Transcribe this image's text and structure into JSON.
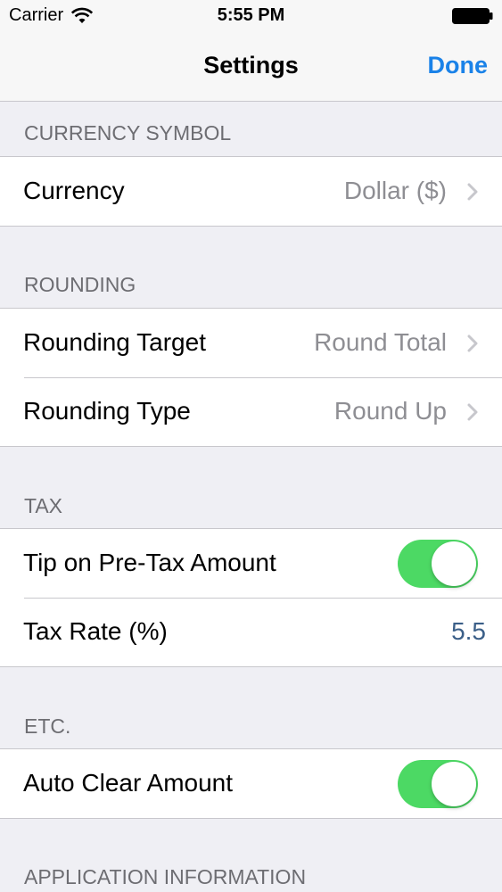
{
  "status_bar": {
    "carrier": "Carrier",
    "time": "5:55 PM",
    "wifi_icon": "wifi-icon",
    "battery_icon": "battery-icon"
  },
  "nav": {
    "title": "Settings",
    "done_label": "Done",
    "accent_color": "#1a82e8"
  },
  "sections": {
    "currency": {
      "header": "CURRENCY SYMBOL",
      "currency_label": "Currency",
      "currency_value": "Dollar ($)"
    },
    "rounding": {
      "header": "ROUNDING",
      "target_label": "Rounding Target",
      "target_value": "Round Total",
      "type_label": "Rounding Type",
      "type_value": "Round Up"
    },
    "tax": {
      "header": "TAX",
      "tip_label": "Tip on Pre-Tax Amount",
      "tip_enabled": true,
      "rate_label": "Tax Rate (%)",
      "rate_value": "5.5"
    },
    "etc": {
      "header": "ETC.",
      "auto_clear_label": "Auto Clear Amount",
      "auto_clear_enabled": true
    },
    "app_info": {
      "header": "APPLICATION INFORMATION"
    }
  },
  "colors": {
    "toggle_on": "#4cd964",
    "background": "#efeff4"
  }
}
